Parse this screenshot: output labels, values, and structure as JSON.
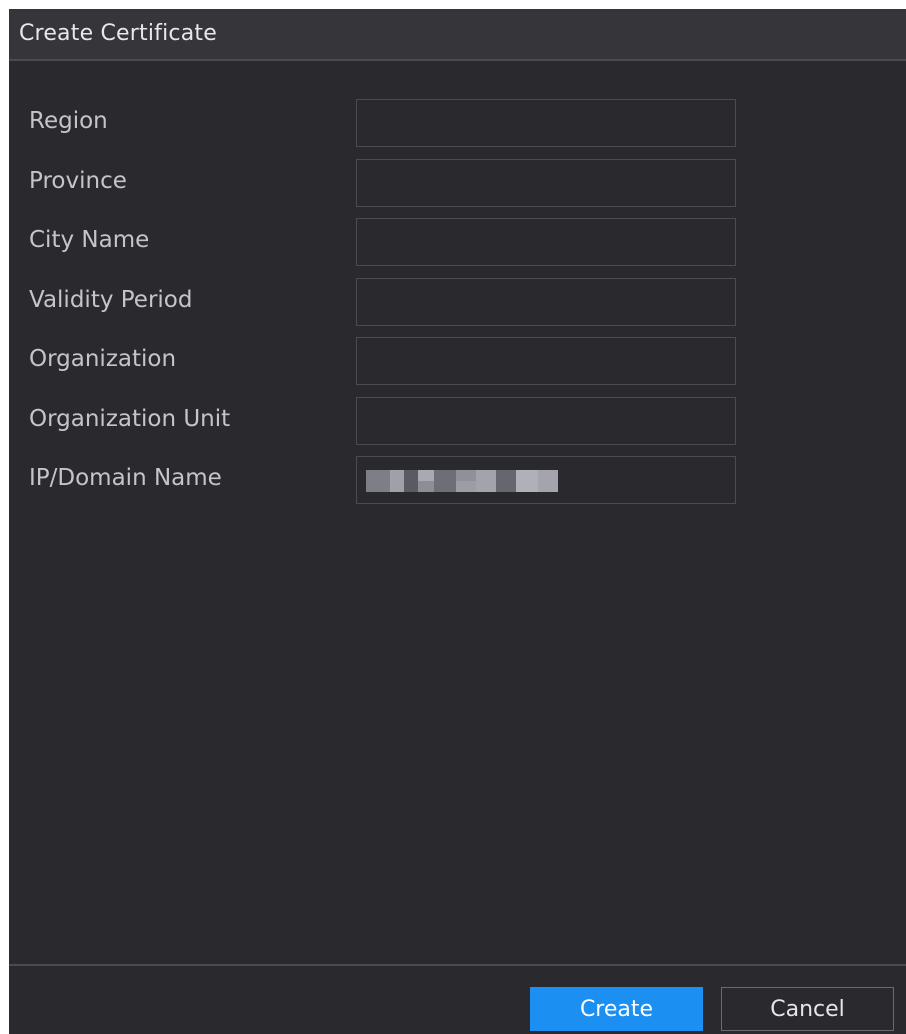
{
  "dialog": {
    "title": "Create Certificate"
  },
  "form": {
    "fields": [
      {
        "label": "Region",
        "value": ""
      },
      {
        "label": "Province",
        "value": ""
      },
      {
        "label": "City Name",
        "value": ""
      },
      {
        "label": "Validity Period",
        "value": ""
      },
      {
        "label": "Organization",
        "value": ""
      },
      {
        "label": "Organization Unit",
        "value": ""
      },
      {
        "label": "IP/Domain Name",
        "value": ""
      }
    ]
  },
  "buttons": {
    "create_label": "Create",
    "cancel_label": "Cancel"
  },
  "colors": {
    "background": "#2a2a2e",
    "titlebar": "#35353a",
    "accent": "#1b8ff2",
    "label_text": "#c4c5c9",
    "input_border": "#4b4c52"
  }
}
